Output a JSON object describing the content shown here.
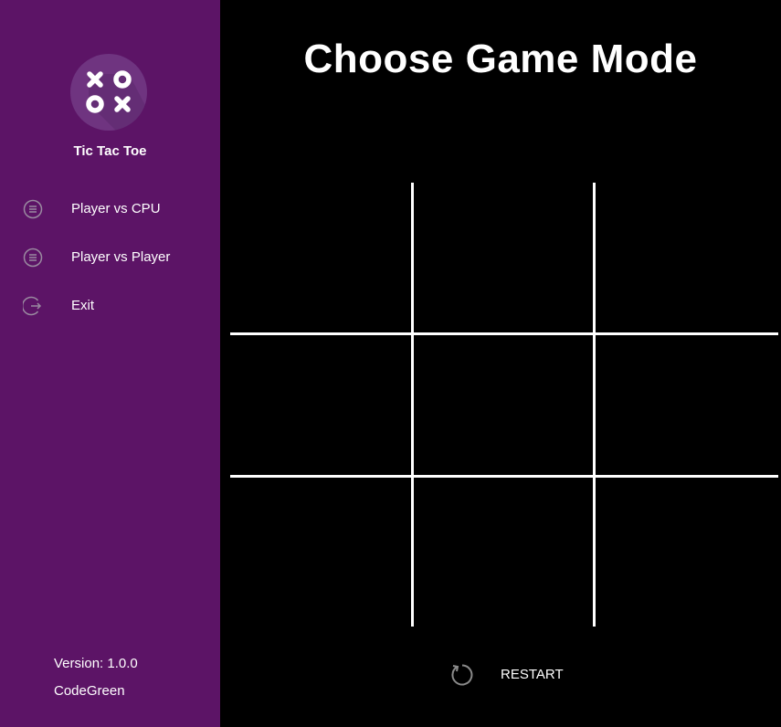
{
  "app": {
    "title": "Tic Tac Toe",
    "logo_icon": "xoox-logo-icon",
    "version": "Version: 1.0.0",
    "author": "CodeGreen"
  },
  "sidebar": {
    "items": [
      {
        "label": "Player vs CPU",
        "icon": "menu-circle-icon"
      },
      {
        "label": "Player vs Player",
        "icon": "menu-circle-icon"
      },
      {
        "label": "Exit",
        "icon": "exit-icon"
      }
    ]
  },
  "main": {
    "title": "Choose Game Mode",
    "board": {
      "cells": [
        "",
        "",
        "",
        "",
        "",
        "",
        "",
        "",
        ""
      ]
    },
    "restart_label": "RESTART",
    "restart_icon": "restart-icon"
  },
  "colors": {
    "sidebar_bg": "#5c1466",
    "main_bg": "#000000",
    "logo_bg": "#6f3480",
    "grid_lines": "#ffffff",
    "icon_gray": "#9a8aa0"
  }
}
